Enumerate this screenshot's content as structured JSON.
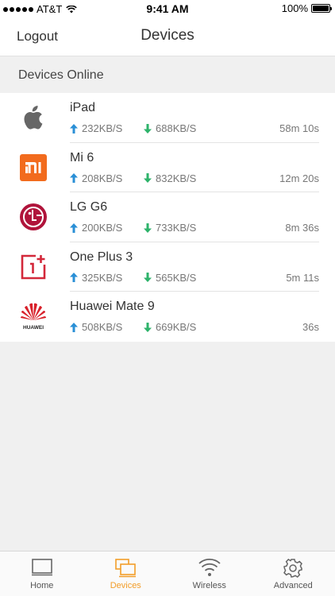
{
  "status_bar": {
    "carrier": "AT&T",
    "time": "9:41 AM",
    "battery": "100%"
  },
  "nav": {
    "left_button": "Logout",
    "title": "Devices"
  },
  "section": {
    "title": "Devices Online"
  },
  "devices": [
    {
      "name": "iPad",
      "upload": "232KB/S",
      "download": "688KB/S",
      "time": "58m 10s",
      "logo": "apple-icon"
    },
    {
      "name": "Mi 6",
      "upload": "208KB/S",
      "download": "832KB/S",
      "time": "12m 20s",
      "logo": "xiaomi-logo"
    },
    {
      "name": "LG G6",
      "upload": "200KB/S",
      "download": "733KB/S",
      "time": "8m 36s",
      "logo": "lg-logo"
    },
    {
      "name": "One Plus 3",
      "upload": "325KB/S",
      "download": "565KB/S",
      "time": "5m 11s",
      "logo": "oneplus-logo"
    },
    {
      "name": "Huawei Mate 9",
      "upload": "508KB/S",
      "download": "669KB/S",
      "time": "36s",
      "logo": "huawei-logo",
      "logo_text": "HUAWEI"
    }
  ],
  "tabs": [
    {
      "label": "Home",
      "icon": "monitor-icon"
    },
    {
      "label": "Devices",
      "icon": "devices-icon",
      "active": true
    },
    {
      "label": "Wireless",
      "icon": "wifi-icon"
    },
    {
      "label": "Advanced",
      "icon": "gear-icon"
    }
  ],
  "colors": {
    "accent": "#f29d29",
    "upload_arrow": "#2a8fd6",
    "download_arrow": "#2eb36b",
    "xiaomi": "#f26b1d",
    "lg": "#b0143b",
    "oneplus": "#d3283a",
    "huawei": "#d8202a"
  }
}
